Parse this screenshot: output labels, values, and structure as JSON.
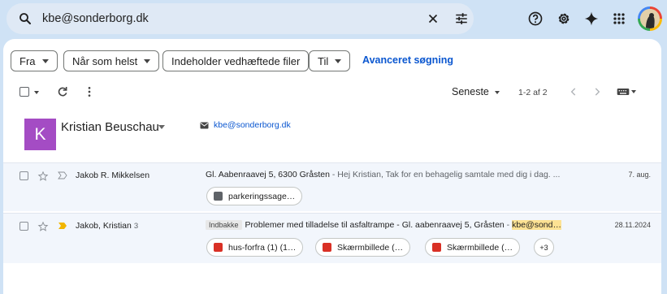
{
  "search": {
    "query": "kbe@sonderborg.dk"
  },
  "filters": {
    "from_label": "Fra",
    "time_label": "Når som helst",
    "attachments_label": "Indeholder vedhæftede filer",
    "to_label": "Til",
    "advanced_label": "Avanceret søgning"
  },
  "toolbar": {
    "sort_label": "Seneste",
    "count": "1-2 af 2"
  },
  "contact": {
    "initial": "K",
    "name": "Kristian Beuschau",
    "email": "kbe@sonderborg.dk",
    "avatar_color": "#a44cc4"
  },
  "emails": [
    {
      "sender": "Jakob R. Mikkelsen",
      "count": "",
      "subject": "Gl. Aabenraavej 5, 6300 Gråsten",
      "snippet": " - Hej Kristian, Tak for en behagelig samtale med dig i dag. ...",
      "date": "7. aug.",
      "label": "",
      "important": false,
      "attachments": [
        {
          "name": "parkeringssage…",
          "type": "doc"
        }
      ],
      "more": ""
    },
    {
      "sender": "Jakob, Kristian",
      "count": "3",
      "subject": "Problemer med tilladelse til asfaltrampe - Gl. aabenraavej 5, Gråsten",
      "snippet_prefix": " - ",
      "highlight": "kbe@sond…",
      "date": "28.11.2024",
      "label": "Indbakke",
      "important": true,
      "attachments": [
        {
          "name": "hus-forfra (1) (1…",
          "type": "img"
        },
        {
          "name": "Skærmbillede (…",
          "type": "img"
        },
        {
          "name": "Skærmbillede (…",
          "type": "img"
        }
      ],
      "more": "+3"
    }
  ],
  "icons": {
    "search": "search-icon",
    "clear": "close-icon",
    "tune": "tune-icon",
    "help": "help-icon",
    "settings": "gear-icon",
    "gemini": "sparkle-icon",
    "apps": "apps-grid-icon"
  }
}
